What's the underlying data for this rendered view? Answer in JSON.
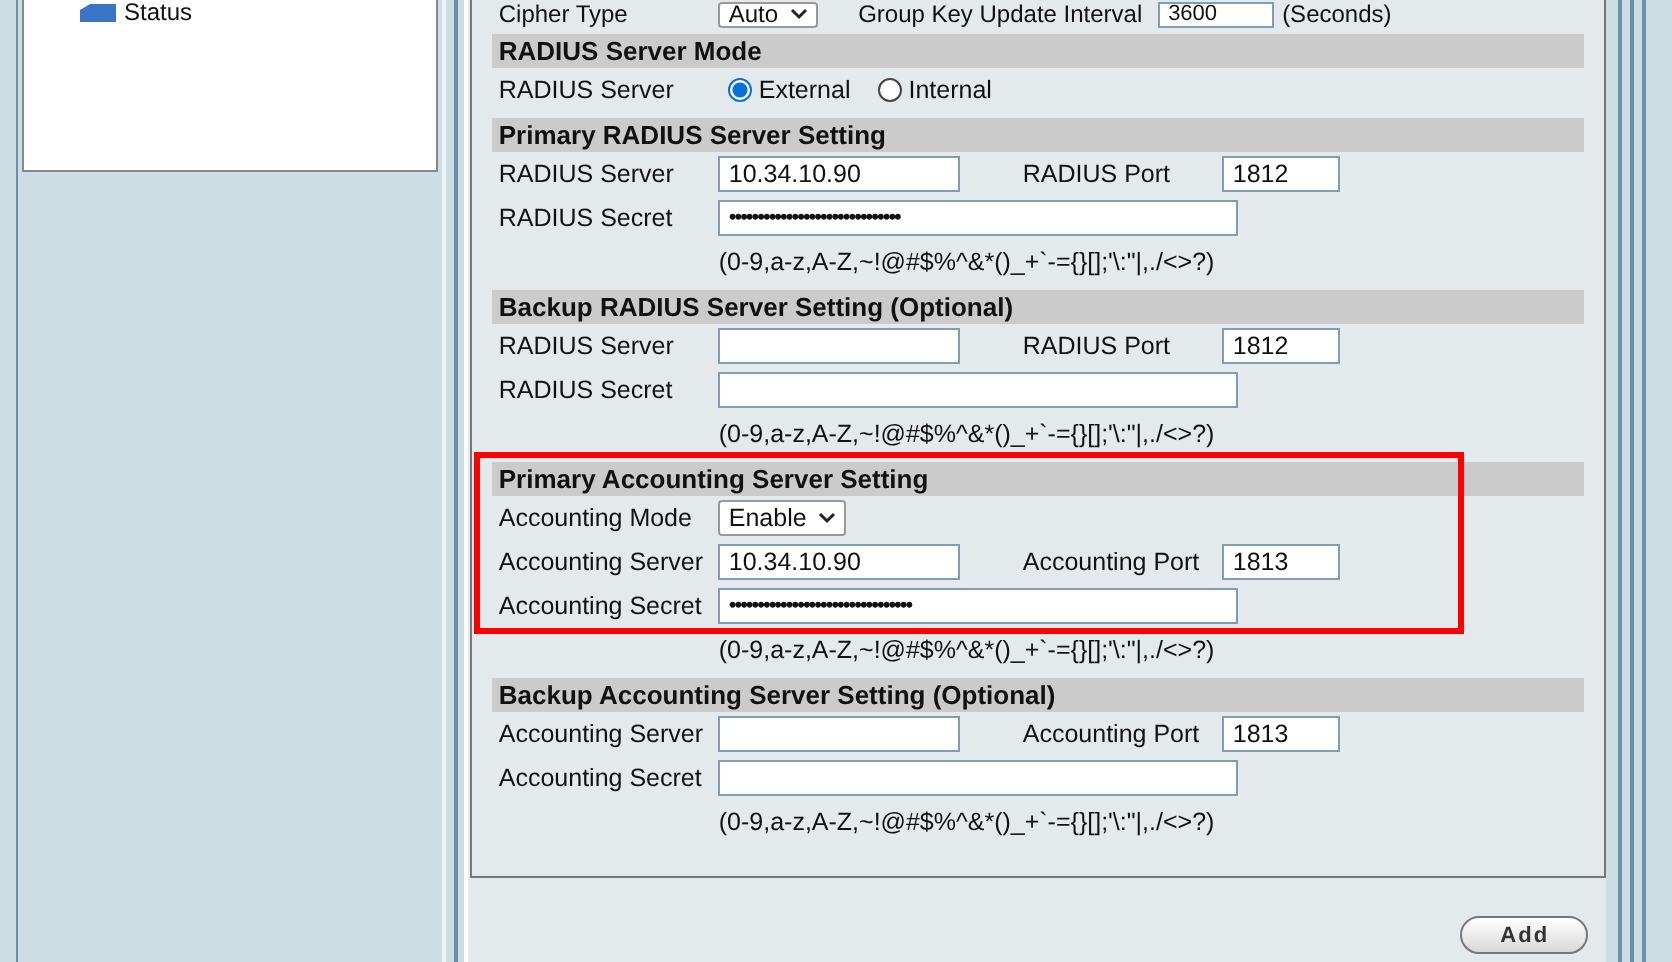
{
  "sidebar": {
    "tree_items": [
      {
        "label": "Status"
      }
    ]
  },
  "top_row": {
    "label": "Cipher Type",
    "select_value": "Auto",
    "interval_label": "Group Key Update Interval",
    "interval_value": "3600",
    "unit": "(Seconds)"
  },
  "sections": [
    {
      "title": "RADIUS Server Mode",
      "highlighted": false,
      "rows": [
        {
          "kind": "radio",
          "label": "RADIUS Server",
          "options": [
            {
              "label": "External",
              "selected": true
            },
            {
              "label": "Internal",
              "selected": false
            }
          ]
        }
      ]
    },
    {
      "title": "Primary RADIUS Server Setting",
      "highlighted": false,
      "rows": [
        {
          "kind": "server",
          "label": "RADIUS Server",
          "value": "10.34.10.90",
          "port_label": "RADIUS Port",
          "port_value": "1812"
        },
        {
          "kind": "secret",
          "label": "RADIUS Secret",
          "value": "••••••••••••••••••••••••••••••"
        },
        {
          "kind": "hint",
          "text": "(0-9,a-z,A-Z,~!@#$%^&*()_+`-={}[];'\\:\"|,./<>?)"
        }
      ]
    },
    {
      "title": "Backup RADIUS Server Setting (Optional)",
      "highlighted": false,
      "rows": [
        {
          "kind": "server",
          "label": "RADIUS Server",
          "port_label": "RADIUS Port",
          "port_value": "1812"
        },
        {
          "kind": "secret",
          "label": "RADIUS Secret"
        },
        {
          "kind": "hint",
          "text": "(0-9,a-z,A-Z,~!@#$%^&*()_+`-={}[];'\\:\"|,./<>?)"
        }
      ]
    },
    {
      "title": "Primary Accounting Server Setting",
      "highlighted": true,
      "rows": [
        {
          "kind": "select",
          "label": "Accounting Mode",
          "value": "Enable"
        },
        {
          "kind": "server",
          "label": "Accounting Server",
          "value": "10.34.10.90",
          "port_label": "Accounting Port",
          "port_value": "1813"
        },
        {
          "kind": "secret",
          "label": "Accounting Secret",
          "value": "••••••••••••••••••••••••••••••••"
        },
        {
          "kind": "hint",
          "text": "(0-9,a-z,A-Z,~!@#$%^&*()_+`-={}[];'\\:\"|,./<>?)"
        }
      ]
    },
    {
      "title": "Backup Accounting Server Setting (Optional)",
      "highlighted": false,
      "rows": [
        {
          "kind": "server",
          "label": "Accounting Server",
          "port_label": "Accounting Port",
          "port_value": "1813"
        },
        {
          "kind": "secret",
          "label": "Accounting Secret"
        },
        {
          "kind": "hint",
          "text": "(0-9,a-z,A-Z,~!@#$%^&*()_+`-={}[];'\\:\"|,./<>?)"
        }
      ]
    }
  ],
  "buttons": [
    {
      "label": "Add"
    }
  ]
}
